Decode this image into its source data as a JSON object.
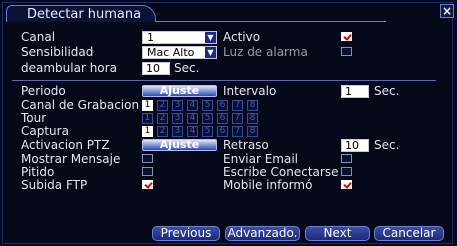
{
  "window": {
    "title": "Detectar humana"
  },
  "fields": {
    "canal_label": "Canal",
    "canal_value": "1",
    "activo_label": "Activo",
    "activo_checked": true,
    "sensibilidad_label": "Sensibilidad",
    "sensibilidad_value": "Mac Alto",
    "luz_label": "Luz de alarma",
    "luz_checked": false,
    "deambular_label": "deambular hora",
    "deambular_value": "10",
    "deambular_unit": "Sec.",
    "periodo_label": "Periodo",
    "periodo_button": "Ajuste",
    "intervalo_label": "Intervalo",
    "intervalo_value": "1",
    "intervalo_unit": "Sec.",
    "canal_grab_label": "Canal de Grabacion",
    "tour_label": "Tour",
    "captura_label": "Captura",
    "ptz_label": "Activacion PTZ",
    "ptz_button": "Ajuste",
    "retraso_label": "Retraso",
    "retraso_value": "10",
    "retraso_unit": "Sec.",
    "mostrar_label": "Mostrar Mensaje",
    "mostrar_checked": false,
    "email_label": "Enviar Email",
    "email_checked": false,
    "pitido_label": "Pitido",
    "pitido_checked": false,
    "escribe_label": "Escribe Conectarse",
    "escribe_checked": false,
    "ftp_label": "Subida FTP",
    "ftp_checked": true,
    "mobile_label": "Mobile informó",
    "mobile_checked": true
  },
  "channels": [
    "1",
    "2",
    "3",
    "4",
    "5",
    "6",
    "7",
    "8"
  ],
  "channel_rows": {
    "grabacion_selected": [
      "1"
    ],
    "tour_selected": [],
    "captura_selected": [
      "1"
    ]
  },
  "buttons": {
    "previous": "Previous",
    "advanced": "Advanzado.",
    "next": "Next",
    "cancel": "Cancelar"
  },
  "icons": {
    "close": "close-icon",
    "dropdown": "chevron-down-icon",
    "check": "check-icon"
  },
  "colors": {
    "background": "#040818",
    "accent": "#3048b0",
    "check": "#dd0000"
  }
}
